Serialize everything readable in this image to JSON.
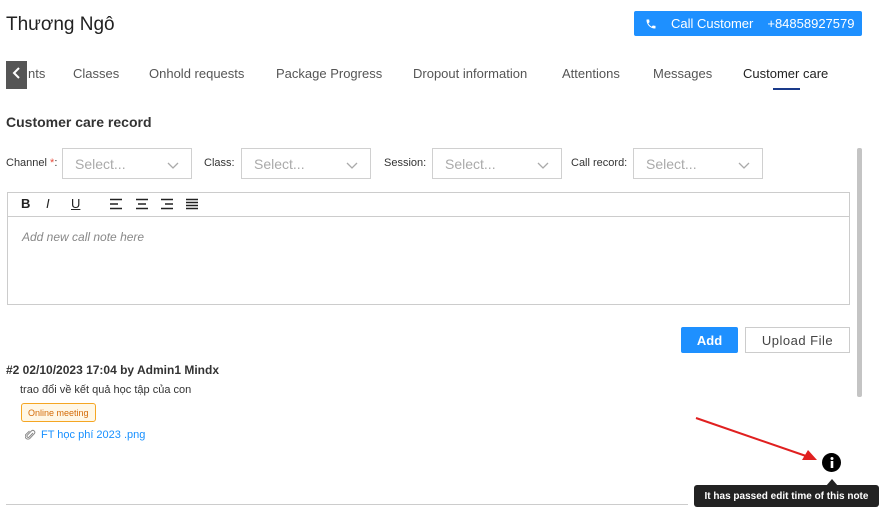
{
  "header": {
    "customer_name": "Thương Ngô",
    "call_button": {
      "label": "Call Customer",
      "phone": "+84858927579",
      "color": "#1e90ff"
    }
  },
  "tabs": [
    {
      "label": "nts"
    },
    {
      "label": "Classes"
    },
    {
      "label": "Onhold requests"
    },
    {
      "label": "Package Progress"
    },
    {
      "label": "Dropout information"
    },
    {
      "label": "Attentions"
    },
    {
      "label": "Messages"
    },
    {
      "label": "Customer care",
      "active": true
    }
  ],
  "section_title": "Customer care record",
  "filters": {
    "channel": {
      "label": "Channel",
      "required_mark": "*",
      "suffix": ":",
      "placeholder": "Select..."
    },
    "class": {
      "label": "Class:",
      "placeholder": "Select..."
    },
    "session": {
      "label": "Session:",
      "placeholder": "Select..."
    },
    "call_record": {
      "label": "Call record:",
      "placeholder": "Select..."
    }
  },
  "editor": {
    "toolbar": {
      "bold": "B",
      "italic": "I",
      "underline": "U"
    },
    "placeholder": "Add new call note here"
  },
  "actions": {
    "add_label": "Add",
    "upload_label": "Upload File"
  },
  "note": {
    "header": "#2 02/10/2023 17:04 by Admin1 Mindx",
    "content": "trao đổi về kết quả học tập của con",
    "tag": "Online meeting",
    "attachment": "FT học phí 2023 .png",
    "info_icon": "info-icon",
    "tooltip": "It has passed edit time of this note"
  },
  "colors": {
    "accent": "#1e90ff",
    "tag_border": "#f5a623",
    "annotation_arrow": "#e02020",
    "tab_underline": "#1a3a8a"
  }
}
